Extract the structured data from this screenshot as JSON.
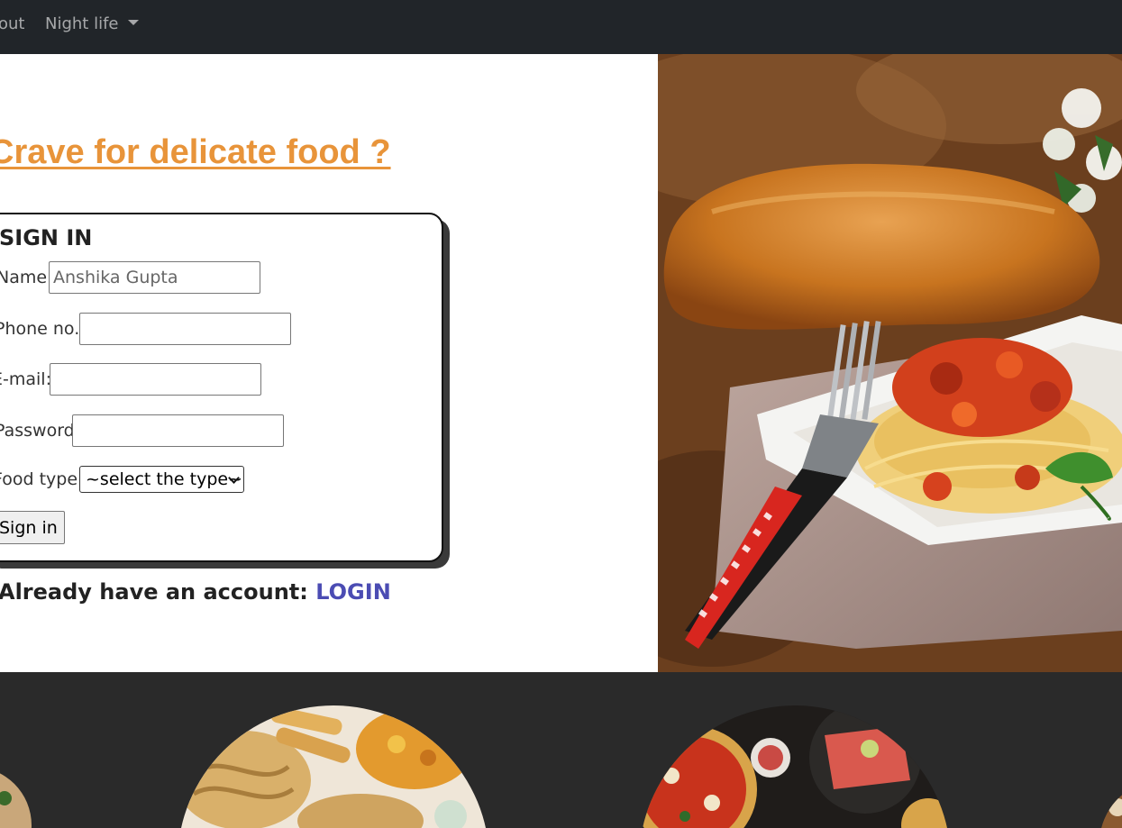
{
  "nav": {
    "items": [
      {
        "label": "out"
      },
      {
        "label": "Night life"
      }
    ]
  },
  "headline": "Crave for delicate food ?",
  "form": {
    "title": "SIGN IN",
    "name_label": "Name:",
    "name_value": "Anshika Gupta",
    "phone_label": "Phone no.:",
    "phone_value": "",
    "email_label": "E-mail:",
    "email_value": "",
    "password_label": "Password:",
    "password_value": "",
    "food_type_label": "Food type:",
    "food_type_selected": "~select the type~",
    "submit_label": "Sign in"
  },
  "account": {
    "prompt": "Already have an account: ",
    "login_label": "LOGIN"
  },
  "colors": {
    "navbar": "#212529",
    "headline": "#e8943a",
    "link": "#4b4cb3",
    "strip": "#2a2a2a"
  },
  "icons": [
    "dropdown-caret-icon",
    "select-chevron-icon"
  ]
}
